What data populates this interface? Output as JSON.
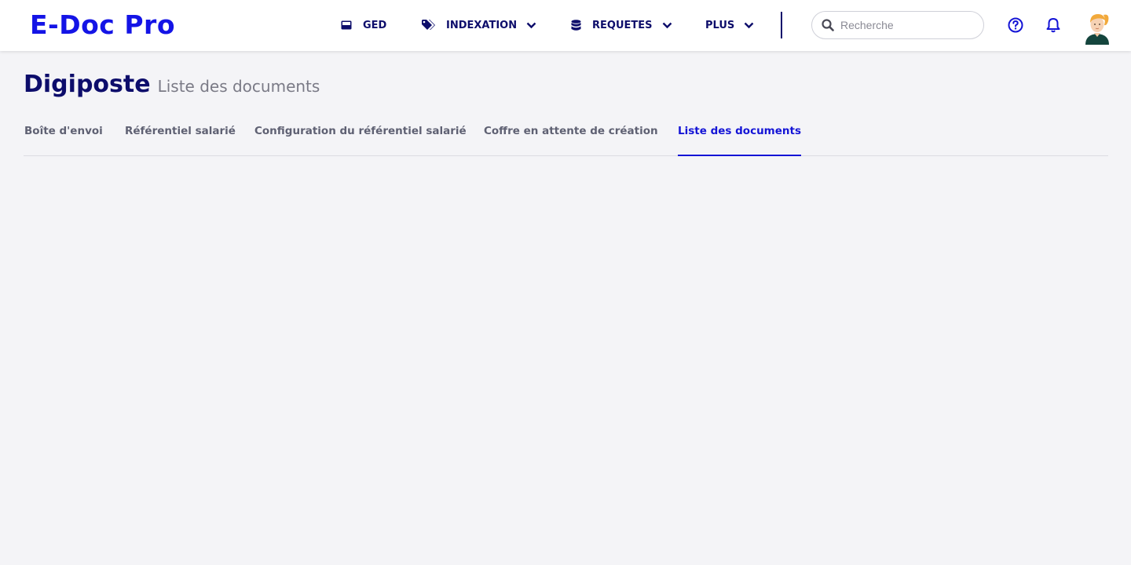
{
  "app": {
    "logo": "E-Doc Pro"
  },
  "nav": {
    "ged": "GED",
    "indexation": "INDEXATION",
    "requetes": "REQUETES",
    "plus": "PLUS"
  },
  "search": {
    "placeholder": "Recherche",
    "value": ""
  },
  "page": {
    "title": "Digiposte",
    "subtitle": "Liste des documents"
  },
  "tabs": [
    {
      "label": "Boîte d'envoi",
      "active": false
    },
    {
      "label": "Référentiel salarié",
      "active": false
    },
    {
      "label": "Configuration du référentiel salarié",
      "active": false
    },
    {
      "label": "Coffre en attente de création",
      "active": false
    },
    {
      "label": "Liste des documents",
      "active": true
    }
  ],
  "colors": {
    "brand": "#1414e6",
    "navy": "#0d0d6b",
    "active_tab": "#1414d6",
    "background": "#f4f4f7"
  },
  "icons": {
    "ged": "inbox-icon",
    "indexation": "tags-icon",
    "requetes": "database-icon",
    "search": "search-icon",
    "help": "help-icon",
    "notifications": "bell-icon"
  }
}
